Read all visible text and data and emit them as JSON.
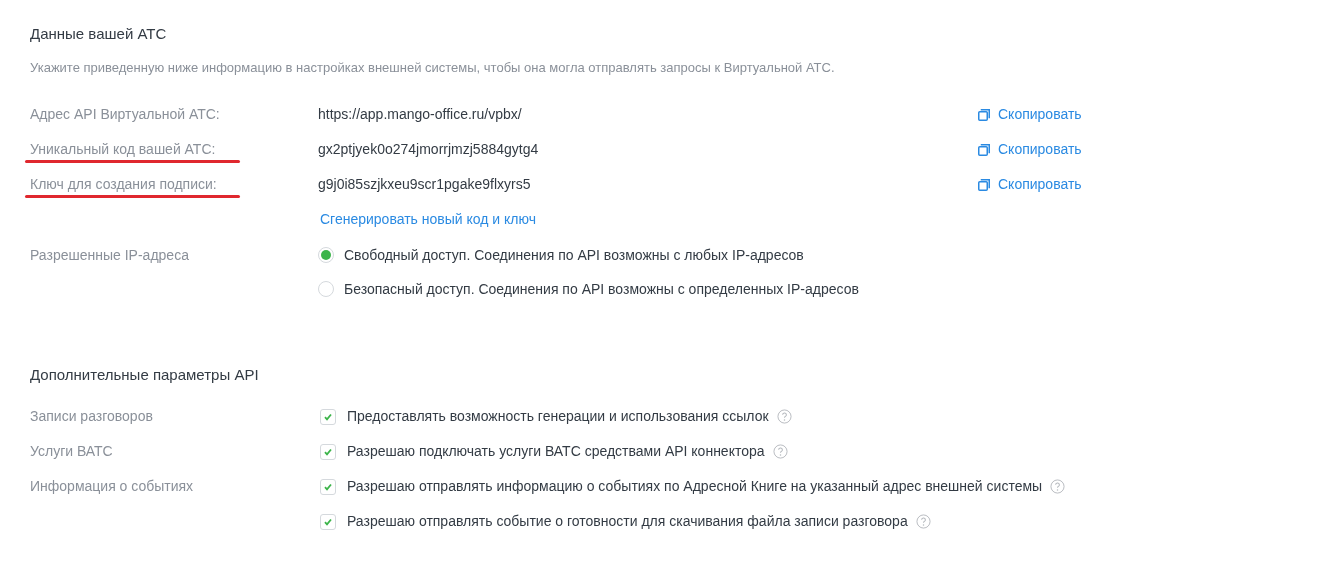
{
  "section_title": "Данные вашей АТС",
  "description": "Укажите приведенную ниже информацию в настройках внешней системы, чтобы она могла отправлять запросы к Виртуальной АТС.",
  "fields": [
    {
      "label": "Адрес API Виртуальной АТС:",
      "value": "https://app.mango-office.ru/vpbx/",
      "copy": "Скопировать",
      "underlined": false
    },
    {
      "label": "Уникальный код вашей АТС:",
      "value": "gx2ptjyek0o274jmorrjmzj5884gytg4",
      "copy": "Скопировать",
      "underlined": true
    },
    {
      "label": "Ключ для создания подписи:",
      "value": "g9j0i85szjkxeu9scr1pgake9flxyrs5",
      "copy": "Скопировать",
      "underlined": true
    }
  ],
  "generate_link": "Сгенерировать новый код и ключ",
  "ip": {
    "label": "Разрешенные IP-адреса",
    "options": [
      {
        "text": "Свободный доступ. Соединения по API возможны с любых IP-адресов",
        "selected": true
      },
      {
        "text": "Безопасный доступ. Соединения по API возможны с определенных IP-адресов",
        "selected": false
      }
    ]
  },
  "extra_title": "Дополнительные параметры API",
  "options": [
    {
      "label": "Записи разговоров",
      "text": "Предоставлять возможность генерации и использования ссылок",
      "checked": true
    },
    {
      "label": "Услуги ВАТС",
      "text": "Разрешаю подключать услуги ВАТС средствами API коннектора",
      "checked": true
    },
    {
      "label": "Информация о событиях",
      "text": "Разрешаю отправлять информацию о событиях по Адресной Книге на указанный адрес внешней системы",
      "checked": true
    },
    {
      "text": "Разрешаю отправлять событие о готовности для скачивания файла записи разговора",
      "checked": true
    }
  ]
}
